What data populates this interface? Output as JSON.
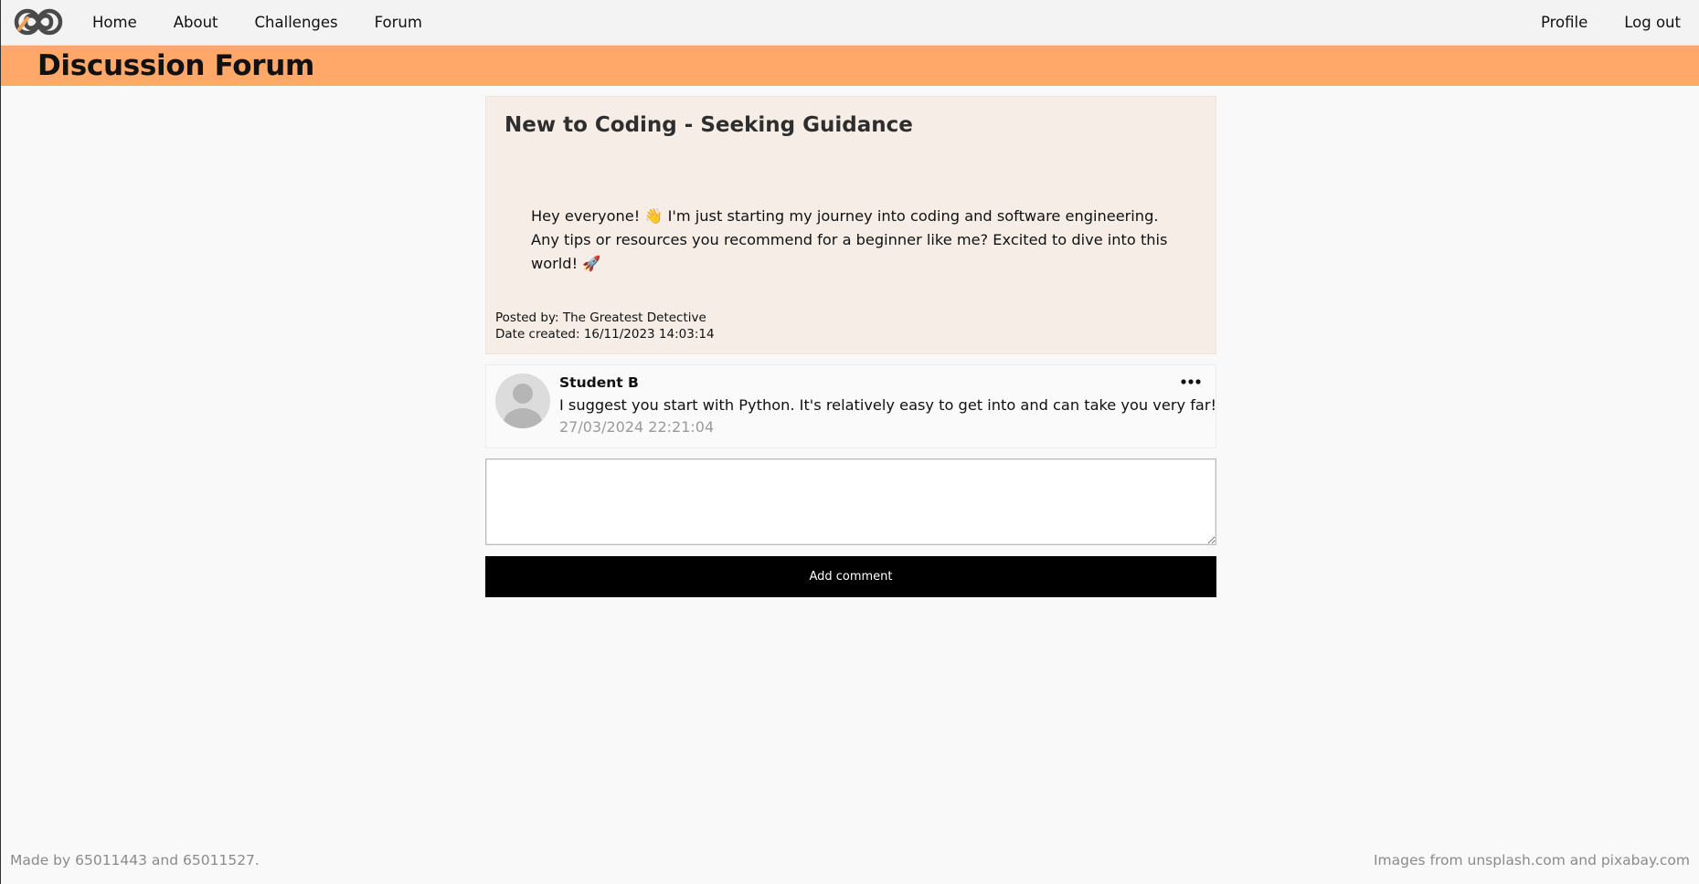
{
  "navbar": {
    "logo_icon": "infinity-logo-icon",
    "left_links": [
      "Home",
      "About",
      "Challenges",
      "Forum"
    ],
    "right_links": [
      "Profile",
      "Log out"
    ]
  },
  "header": {
    "title": "Discussion Forum",
    "background_color": "#ffa86a"
  },
  "post": {
    "title": "New to Coding - Seeking Guidance",
    "body": "Hey everyone! 👋 I'm just starting my journey into coding and software engineering. Any tips or resources you recommend for a beginner like me? Excited to dive into this world! 🚀",
    "posted_by": "Posted by: The Greatest Detective",
    "date_created": "Date created: 16/11/2023 14:03:14",
    "background_color": "#f5ede6"
  },
  "comments": [
    {
      "author": "Student B",
      "text": "I suggest you start with Python. It's relatively easy to get into and can take you very far!",
      "date": "27/03/2024 22:21:04",
      "avatar_icon": "default-user-avatar-icon",
      "menu_icon": "more-options-icon"
    }
  ],
  "comment_form": {
    "input_value": "",
    "input_placeholder": "",
    "submit_label": "Add comment"
  },
  "footer": {
    "left": "Made by 65011443 and 65011527.",
    "right": "Images from unsplash.com and pixabay.com"
  }
}
